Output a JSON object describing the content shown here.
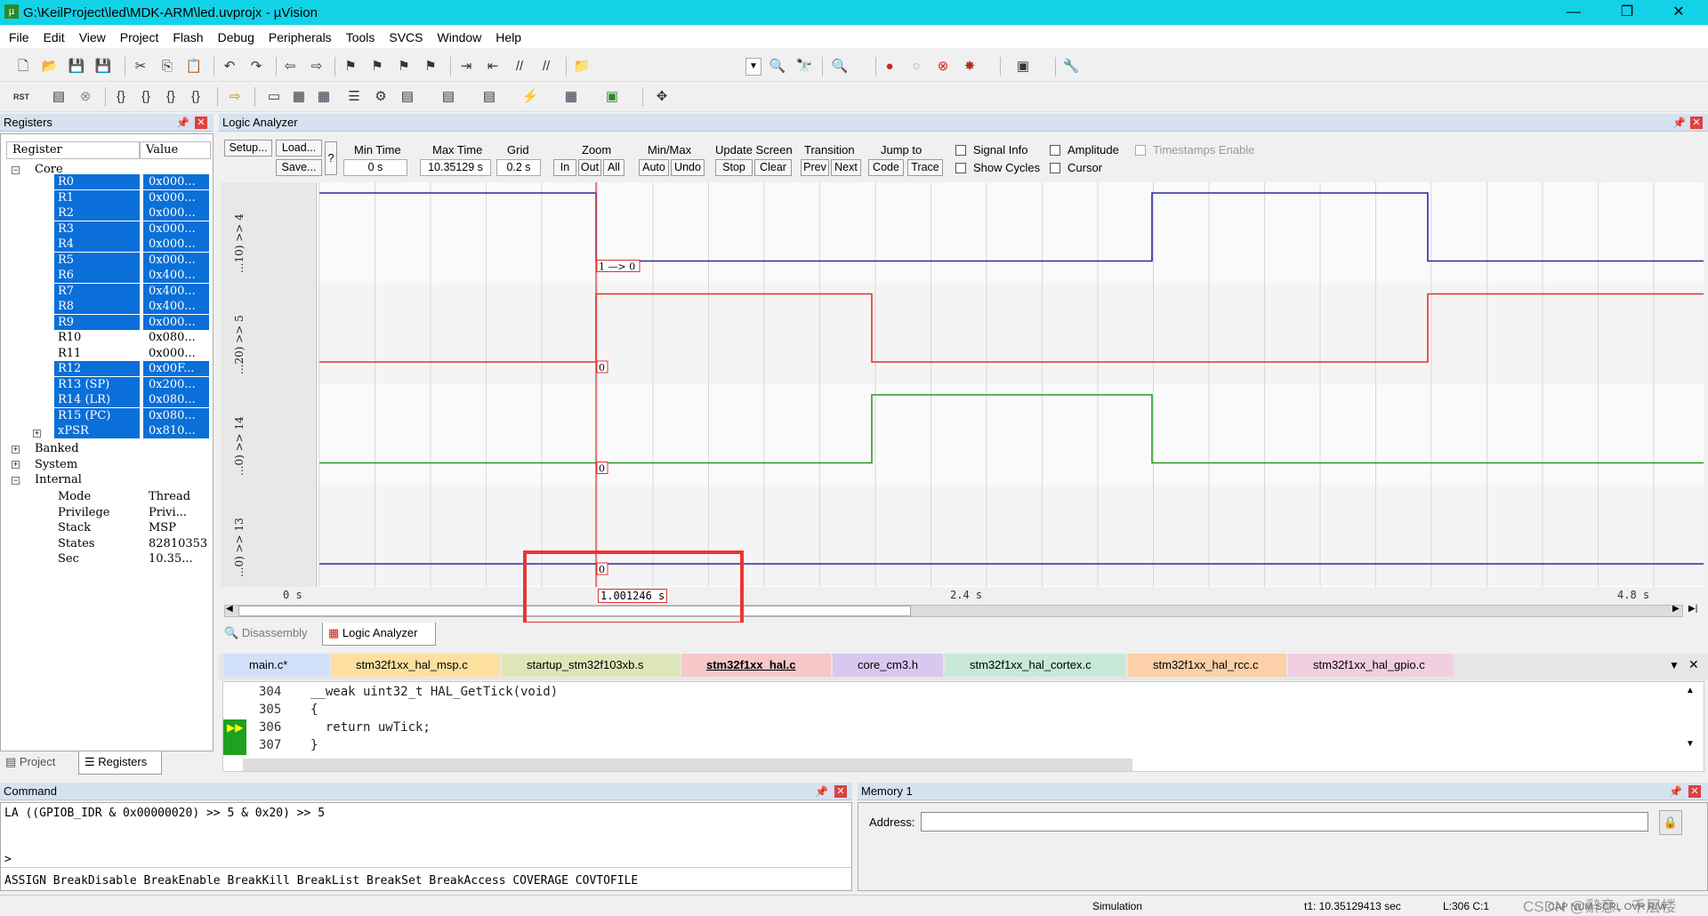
{
  "window": {
    "title": "G:\\KeilProject\\led\\MDK-ARM\\led.uvprojx - µVision",
    "min": "—",
    "max": "❐",
    "close": "✕"
  },
  "menu": [
    "File",
    "Edit",
    "View",
    "Project",
    "Flash",
    "Debug",
    "Peripherals",
    "Tools",
    "SVCS",
    "Window",
    "Help"
  ],
  "toolbar2": {
    "rst": "RST"
  },
  "registers": {
    "title": "Registers",
    "col_register": "Register",
    "col_value": "Value",
    "core": "Core",
    "rows": [
      {
        "n": "R0",
        "v": "0x000...",
        "sel": true
      },
      {
        "n": "R1",
        "v": "0x000...",
        "sel": true
      },
      {
        "n": "R2",
        "v": "0x000...",
        "sel": true
      },
      {
        "n": "R3",
        "v": "0x000...",
        "sel": true
      },
      {
        "n": "R4",
        "v": "0x000...",
        "sel": true
      },
      {
        "n": "R5",
        "v": "0x000...",
        "sel": true
      },
      {
        "n": "R6",
        "v": "0x400...",
        "sel": true
      },
      {
        "n": "R7",
        "v": "0x400...",
        "sel": true
      },
      {
        "n": "R8",
        "v": "0x400...",
        "sel": true
      },
      {
        "n": "R9",
        "v": "0x000...",
        "sel": true
      },
      {
        "n": "R10",
        "v": "0x080...",
        "sel": false
      },
      {
        "n": "R11",
        "v": "0x000...",
        "sel": false
      },
      {
        "n": "R12",
        "v": "0x00F...",
        "sel": true
      },
      {
        "n": "R13 (SP)",
        "v": "0x200...",
        "sel": true
      },
      {
        "n": "R14 (LR)",
        "v": "0x080...",
        "sel": true
      },
      {
        "n": "R15 (PC)",
        "v": "0x080...",
        "sel": true
      },
      {
        "n": "xPSR",
        "v": "0x810...",
        "sel": true
      }
    ],
    "banked": "Banked",
    "system": "System",
    "internal": "Internal",
    "internal_rows": [
      {
        "n": "Mode",
        "v": "Thread"
      },
      {
        "n": "Privilege",
        "v": "Privi..."
      },
      {
        "n": "Stack",
        "v": "MSP"
      },
      {
        "n": "States",
        "v": "82810353"
      },
      {
        "n": "Sec",
        "v": "10.35..."
      }
    ],
    "tab_project": "Project",
    "tab_registers": "Registers"
  },
  "la": {
    "title": "Logic Analyzer",
    "setup": "Setup...",
    "load": "Load...",
    "save": "Save...",
    "help": "?",
    "min_time_label": "Min Time",
    "min_time": "0 s",
    "max_time_label": "Max Time",
    "max_time": "10.35129 s",
    "grid_label": "Grid",
    "grid": "0.2 s",
    "zoom_label": "Zoom",
    "zoom_in": "In",
    "zoom_out": "Out",
    "zoom_all": "All",
    "minmax_label": "Min/Max",
    "auto": "Auto",
    "undo": "Undo",
    "update_label": "Update Screen",
    "stop": "Stop",
    "clear": "Clear",
    "transition_label": "Transition",
    "prev": "Prev",
    "next": "Next",
    "jump_label": "Jump to",
    "code": "Code",
    "trace": "Trace",
    "signal_info": "Signal Info",
    "show_cycles": "Show Cycles",
    "amplitude": "Amplitude",
    "cursor": "Cursor",
    "timestamps": "Timestamps Enable",
    "signals": [
      {
        "label": "...10) >> 4",
        "color": "#2a2a9a"
      },
      {
        "label": "...20) >> 5",
        "color": "#e03030"
      },
      {
        "label": "...0) >> 14",
        "color": "#2a9a2a"
      },
      {
        "label": "...0) >> 13",
        "color": "#2a2a9a"
      }
    ],
    "hi": "1",
    "lo": "0",
    "marker_texts": [
      "1 —> 0",
      "0",
      "0",
      "0"
    ],
    "cursor_time": "1.001246 s",
    "t0": "0 s",
    "t1": "2.4 s",
    "t2": "4.8 s"
  },
  "bottom_tabs": {
    "disassembly": "Disassembly",
    "la": "Logic Analyzer"
  },
  "files": [
    "main.c*",
    "stm32f1xx_hal_msp.c",
    "startup_stm32f103xb.s",
    "stm32f1xx_hal.c",
    "core_cm3.h",
    "stm32f1xx_hal_cortex.c",
    "stm32f1xx_hal_rcc.c",
    "stm32f1xx_hal_gpio.c"
  ],
  "code": [
    {
      "ln": "304",
      "txt": "__weak uint32_t HAL_GetTick(void)"
    },
    {
      "ln": "305",
      "txt": "{"
    },
    {
      "ln": "306",
      "txt": "  return uwTick;"
    },
    {
      "ln": "307",
      "txt": "}"
    }
  ],
  "command": {
    "title": "Command",
    "line": "LA ((GPIOB_IDR & 0x00000020) >> 5 & 0x20) >> 5",
    "prompt": ">",
    "hint": "ASSIGN BreakDisable BreakEnable BreakKill BreakList BreakSet BreakAccess COVERAGE COVTOFILE"
  },
  "memory": {
    "title": "Memory 1",
    "address_label": "Address:"
  },
  "status": {
    "mode": "Simulation",
    "t1": "t1: 10.35129413 sec",
    "pos": "L:306 C:1",
    "flags": "CAP  NUM  SCRL  OVR  R/W",
    "watermark": "CSDN @辭意、千层楼"
  }
}
